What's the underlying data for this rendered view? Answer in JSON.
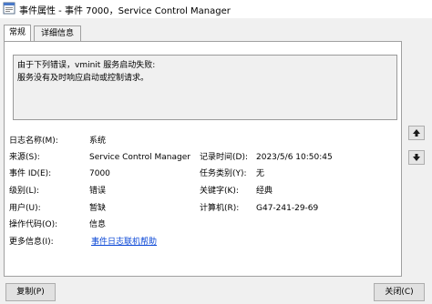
{
  "window": {
    "title": "事件属性 - 事件 7000，Service Control Manager"
  },
  "tabs": [
    {
      "label": "常规"
    },
    {
      "label": "详细信息"
    }
  ],
  "description": {
    "line1": "由于下列错误，vminit 服务启动失败:",
    "line2": "服务没有及时响应启动或控制请求。"
  },
  "fields": {
    "log_name": {
      "label": "日志名称(M):",
      "value": "系统"
    },
    "source": {
      "label": "来源(S):",
      "value": "Service Control Manager"
    },
    "event_id": {
      "label": "事件 ID(E):",
      "value": "7000"
    },
    "level": {
      "label": "级别(L):",
      "value": "错误"
    },
    "user": {
      "label": "用户(U):",
      "value": "暂缺"
    },
    "opcode": {
      "label": "操作代码(O):",
      "value": "信息"
    },
    "more_info": {
      "label": "更多信息(I):",
      "value": "事件日志联机帮助"
    },
    "logged": {
      "label": "记录时间(D):",
      "value": "2023/5/6 10:50:45"
    },
    "task_category": {
      "label": "任务类别(Y):",
      "value": "无"
    },
    "keywords": {
      "label": "关键字(K):",
      "value": "经典"
    },
    "computer": {
      "label": "计算机(R):",
      "value": "G47-241-29-69"
    }
  },
  "buttons": {
    "copy": "复制(P)",
    "close": "关闭(C)"
  },
  "icons": {
    "app": "event-viewer-icon",
    "up": "arrow-up-icon",
    "down": "arrow-down-icon"
  }
}
